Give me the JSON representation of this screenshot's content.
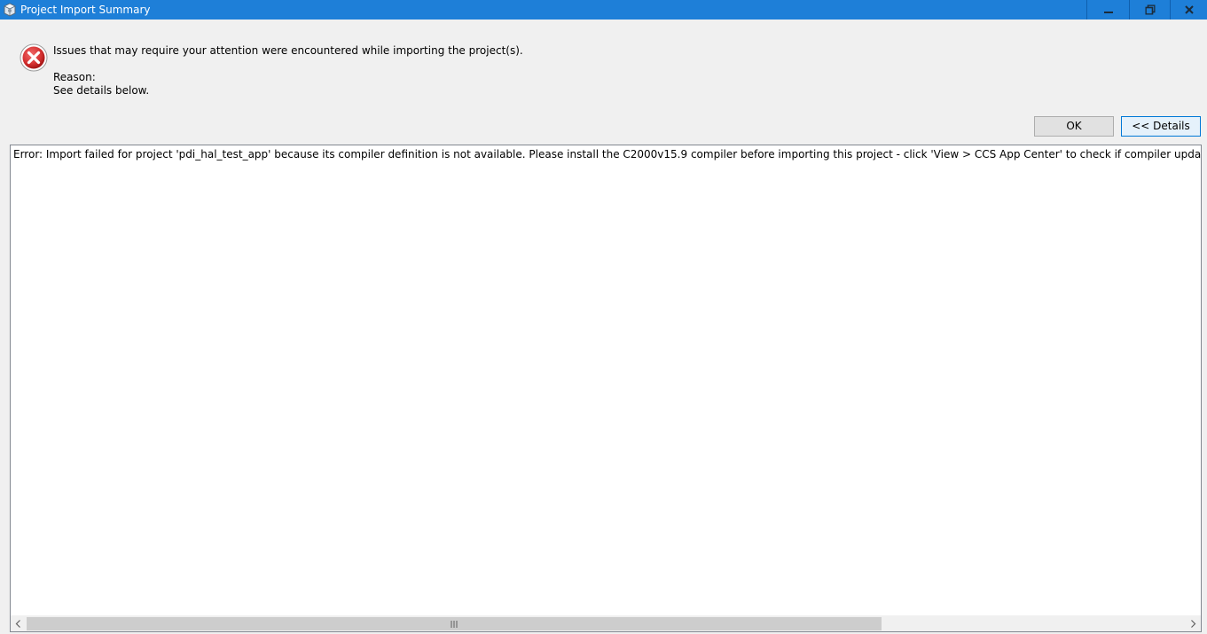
{
  "window": {
    "title": "Project Import Summary"
  },
  "message": {
    "headline": "Issues that may require your attention were encountered while importing the project(s).",
    "reason_label": "Reason:",
    "reason_text": "See details below."
  },
  "buttons": {
    "ok_label": "OK",
    "details_label": "<< Details"
  },
  "details": {
    "text": "Error: Import failed for project 'pdi_hal_test_app' because its compiler definition is not available. Please install the C2000v15.9 compiler before importing this project - click 'View > CCS App Center' to check if compiler updates are available, or install the compiler manually and register it with CCS through 'Window > Preferences > Code Composer Studio > Build > Compilers'."
  },
  "icons": {
    "app": "app-icon",
    "error": "error-icon",
    "minimize": "minimize-icon",
    "maximize": "restore-icon",
    "close": "close-icon",
    "scroll_left": "chevron-left-icon",
    "scroll_right": "chevron-right-icon"
  },
  "colors": {
    "titlebar": "#1e7fd8",
    "error_red": "#d32f2f",
    "dialog_bg": "#f0f0f0"
  }
}
